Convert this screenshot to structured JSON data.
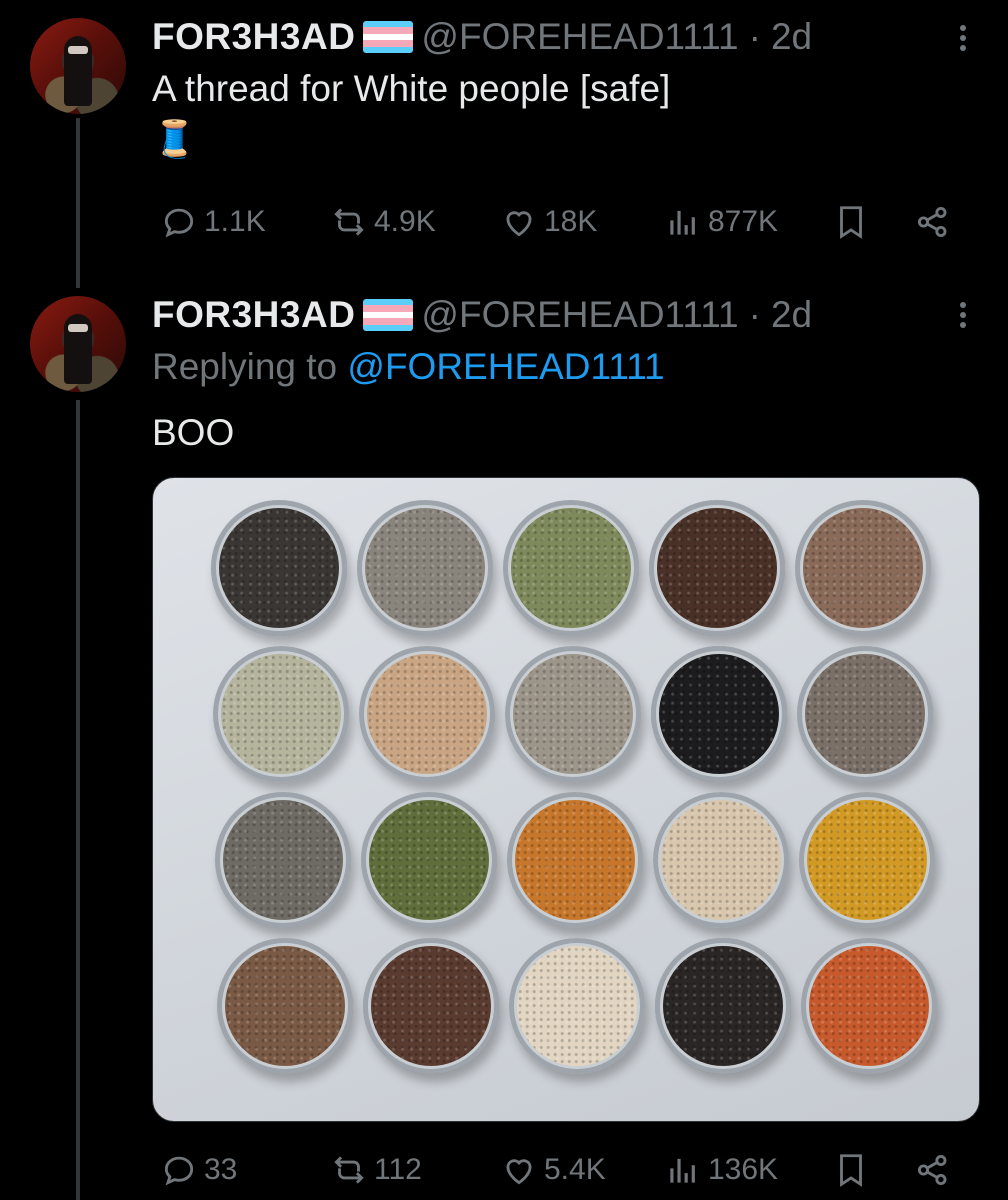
{
  "tweets": [
    {
      "display_name": "FOR3H3AD",
      "handle": "@FOREHEAD1111",
      "separator": "·",
      "time": "2d",
      "text": "A thread for White people [safe]",
      "emoji": "🧵",
      "stats": {
        "replies": "1.1K",
        "reposts": "4.9K",
        "likes": "18K",
        "views": "877K"
      }
    },
    {
      "display_name": "FOR3H3AD",
      "handle": "@FOREHEAD1111",
      "separator": "·",
      "time": "2d",
      "replying_prefix": "Replying to",
      "replying_to": "@FOREHEAD1111",
      "text": "BOO",
      "stats": {
        "replies": "33",
        "reposts": "112",
        "likes": "5.4K",
        "views": "136K"
      }
    }
  ],
  "media": {
    "tin_colors": [
      "#3a3634",
      "#8a857c",
      "#7f8a5c",
      "#4a3127",
      "#8a6a58",
      "#b5b49c",
      "#c9a583",
      "#9c958a",
      "#1c1c1e",
      "#7a7068",
      "#6e6a64",
      "#5f6e3a",
      "#c7772c",
      "#d8c6ad",
      "#d29a24",
      "#7a5a45",
      "#5a3b30",
      "#e2d6c2",
      "#2b2626",
      "#c75a2c"
    ]
  },
  "colors": {
    "background": "#000000",
    "text_primary": "#e7e9ea",
    "text_secondary": "#71767b",
    "link": "#1d9bf0",
    "flag_stripes": [
      "#5bcefa",
      "#f5a9b8",
      "#ffffff",
      "#f5a9b8",
      "#5bcefa"
    ]
  }
}
